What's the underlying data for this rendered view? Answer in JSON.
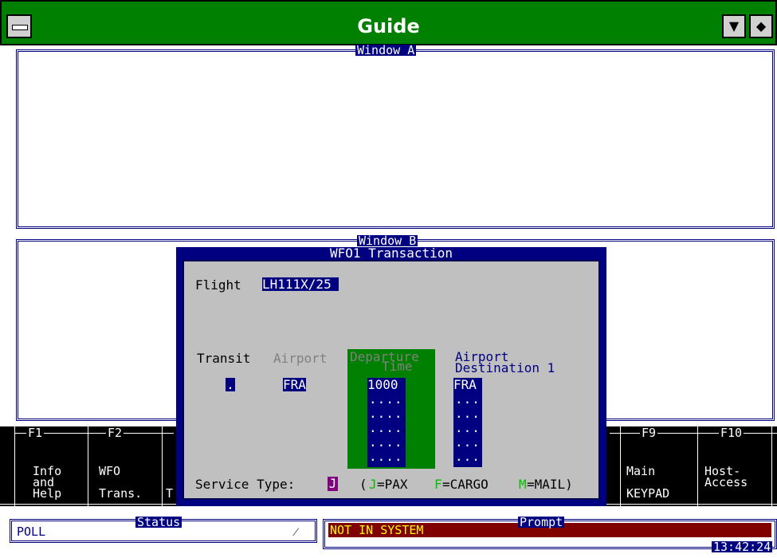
{
  "titlebar": {
    "title": "Guide",
    "dropdown_icon": "▼",
    "updown_icon": "◆"
  },
  "window_a": {
    "title": "Window A"
  },
  "window_b": {
    "title": "Window B"
  },
  "dialog": {
    "title": "WFO1 Transaction",
    "flight_label": "Flight",
    "flight_value": "LH111X/25 ",
    "transit_label": "Transit",
    "airport_label": "Airport",
    "departure_label_1": "Departure",
    "departure_label_2": "Time",
    "dest_label_1": "Airport",
    "dest_label_2": "Destination 1",
    "transit_value": ".",
    "airport_value": "FRA",
    "departure_value": "1000",
    "dest_value": "FRA",
    "dots_row": "....",
    "dots_row_short": "...",
    "service_label": "Service Type:",
    "service_value": "J",
    "legend_open": "(",
    "legend_j_key": "J",
    "legend_j_text": "=PAX",
    "legend_f_key": "F",
    "legend_f_text": "=CARGO",
    "legend_m_key": "M",
    "legend_m_text": "=MAIL)"
  },
  "fkeys": [
    {
      "key": "F1",
      "label": "Info\nand\nHelp"
    },
    {
      "key": "F2",
      "label": "WFO\n\nTrans."
    },
    {
      "key": "F9",
      "label": "Main\n\nKEYPAD"
    },
    {
      "key": "F10",
      "label": "Host-\nAccess"
    }
  ],
  "fkey_partial": "T",
  "status": {
    "title": "Status",
    "value": "POLL",
    "icon": "⁄"
  },
  "prompt": {
    "title": "Prompt",
    "value": "NOT IN SYSTEM",
    "time": "13:42:24"
  },
  "colors": {
    "titlebar": "#008000",
    "navy": "#000080",
    "dialog_bg": "#c0c0c0",
    "prompt_bar": "#800000",
    "prompt_text": "#ffff00",
    "legend_j": "#00c000",
    "legend_f": "#00c000",
    "legend_m": "#00c000",
    "service_box": "#800080"
  }
}
